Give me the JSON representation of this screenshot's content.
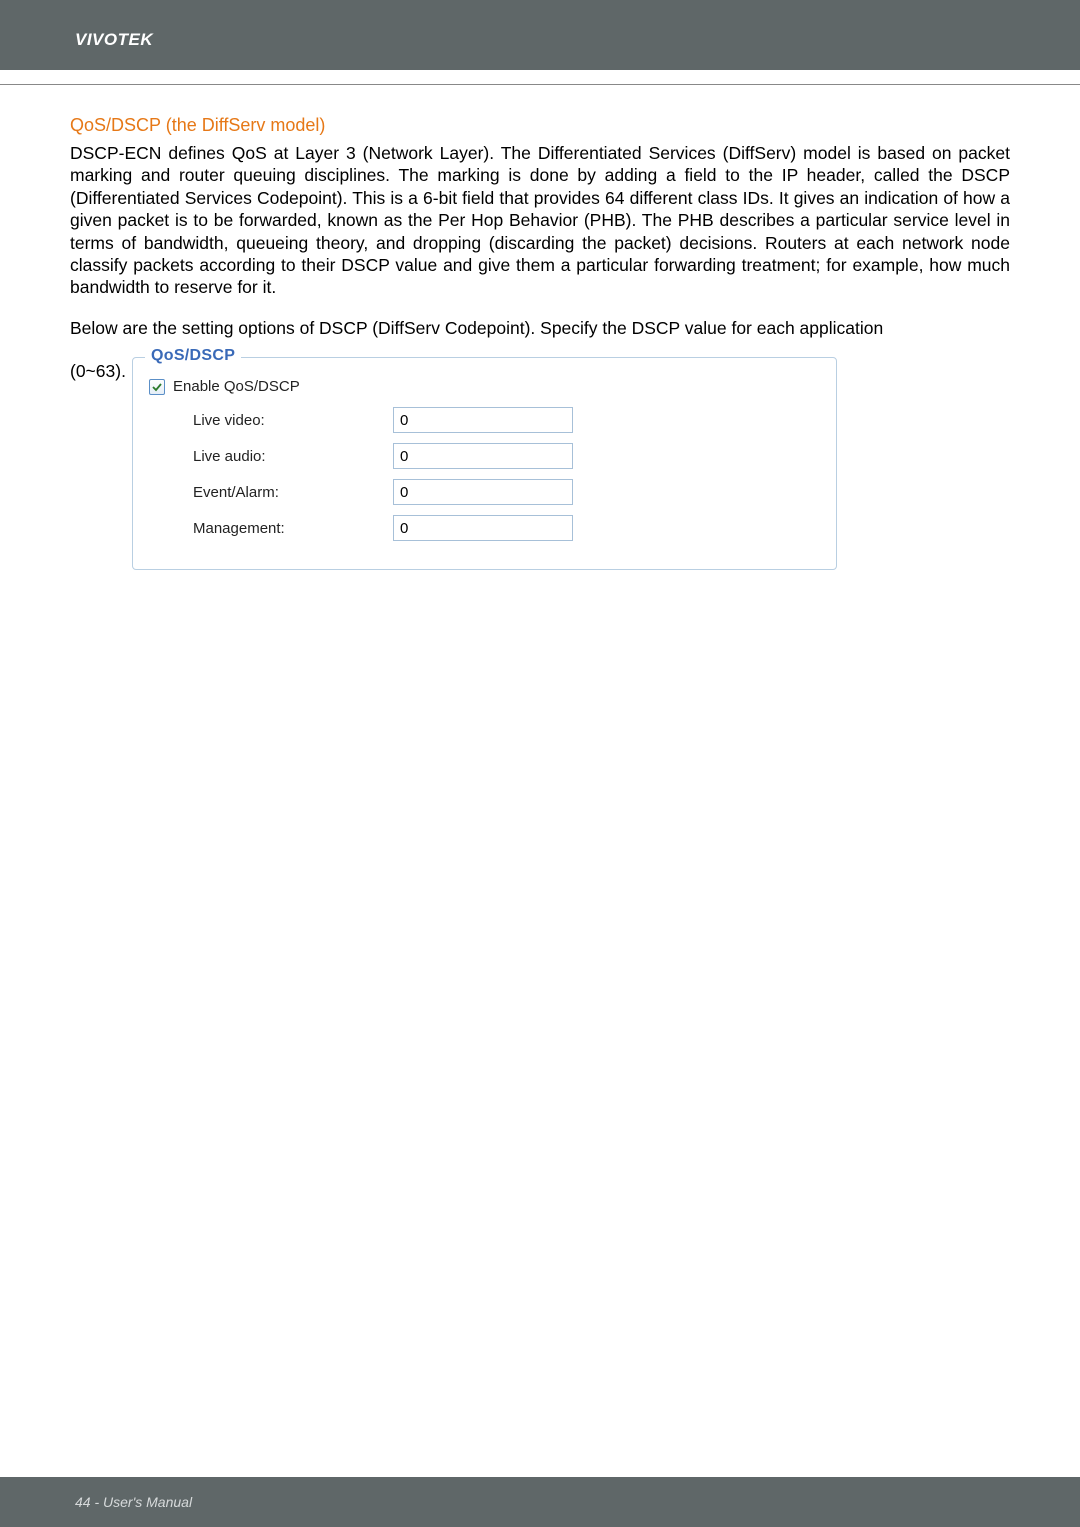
{
  "header": {
    "brand": "VIVOTEK"
  },
  "section": {
    "title": "QoS/DSCP (the DiffServ model)",
    "paragraph1": "DSCP-ECN defines QoS at Layer 3 (Network Layer). The Differentiated Services (DiffServ) model is based on packet marking and router queuing disciplines. The marking is done by adding a field to the IP header, called the DSCP (Differentiated Services Codepoint). This is a 6-bit field that provides 64 different class IDs. It gives an indication of how a given packet is to be forwarded, known as the Per Hop Behavior (PHB). The PHB describes a particular service level in terms of bandwidth, queueing theory, and dropping (discarding the packet) decisions. Routers at each network node classify packets according to their DSCP value and give them a particular forwarding treatment; for example, how much bandwidth to reserve for it.",
    "paragraph2": "Below are the setting options of DSCP (DiffServ Codepoint). Specify the DSCP value for each application (0~63)."
  },
  "prefix": "(0~63).",
  "fieldset": {
    "legend": "QoS/DSCP",
    "checkbox_label": "Enable QoS/DSCP",
    "fields": [
      {
        "label": "Live video:",
        "value": "0"
      },
      {
        "label": "Live audio:",
        "value": "0"
      },
      {
        "label": "Event/Alarm:",
        "value": "0"
      },
      {
        "label": "Management:",
        "value": "0"
      }
    ]
  },
  "footer": {
    "text": "44 - User's Manual"
  }
}
